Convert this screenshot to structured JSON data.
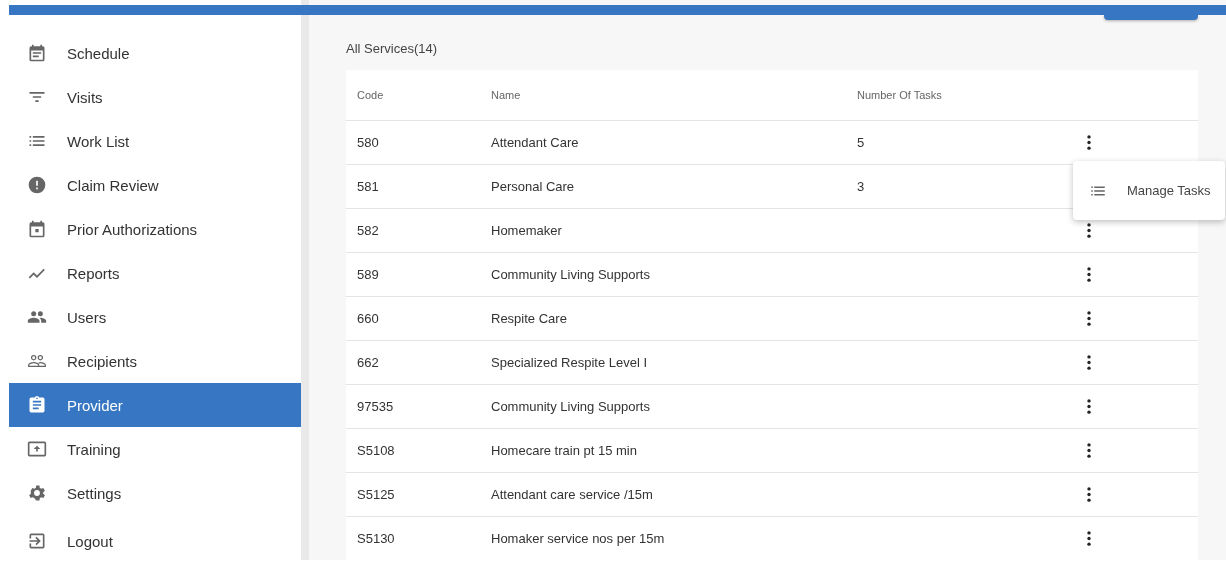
{
  "sidebar": {
    "items": [
      {
        "label": "Schedule",
        "selected": false
      },
      {
        "label": "Visits",
        "selected": false
      },
      {
        "label": "Work List",
        "selected": false
      },
      {
        "label": "Claim Review",
        "selected": false
      },
      {
        "label": "Prior Authorizations",
        "selected": false
      },
      {
        "label": "Reports",
        "selected": false
      },
      {
        "label": "Users",
        "selected": false
      },
      {
        "label": "Recipients",
        "selected": false
      },
      {
        "label": "Provider",
        "selected": true
      },
      {
        "label": "Training",
        "selected": false
      },
      {
        "label": "Settings",
        "selected": false
      },
      {
        "label": "Logout",
        "selected": false
      }
    ]
  },
  "services": {
    "title": "All Services(14)",
    "columns": [
      "Code",
      "Name",
      "Number Of Tasks"
    ],
    "rows": [
      {
        "code": "580",
        "name": "Attendant Care",
        "tasks": "5"
      },
      {
        "code": "581",
        "name": "Personal Care",
        "tasks": "3"
      },
      {
        "code": "582",
        "name": "Homemaker"
      },
      {
        "code": "589",
        "name": "Community Living Supports"
      },
      {
        "code": "660",
        "name": "Respite Care"
      },
      {
        "code": "662",
        "name": "Specialized Respite Level I"
      },
      {
        "code": "97535",
        "name": "Community Living Supports"
      },
      {
        "code": "S5108",
        "name": "Homecare train pt 15 min"
      },
      {
        "code": "S5125",
        "name": "Attendant care service /15m"
      },
      {
        "code": "S5130",
        "name": "Homaker service nos per 15m"
      }
    ]
  },
  "context_menu": {
    "items": [
      {
        "label": "Manage Tasks"
      }
    ]
  }
}
